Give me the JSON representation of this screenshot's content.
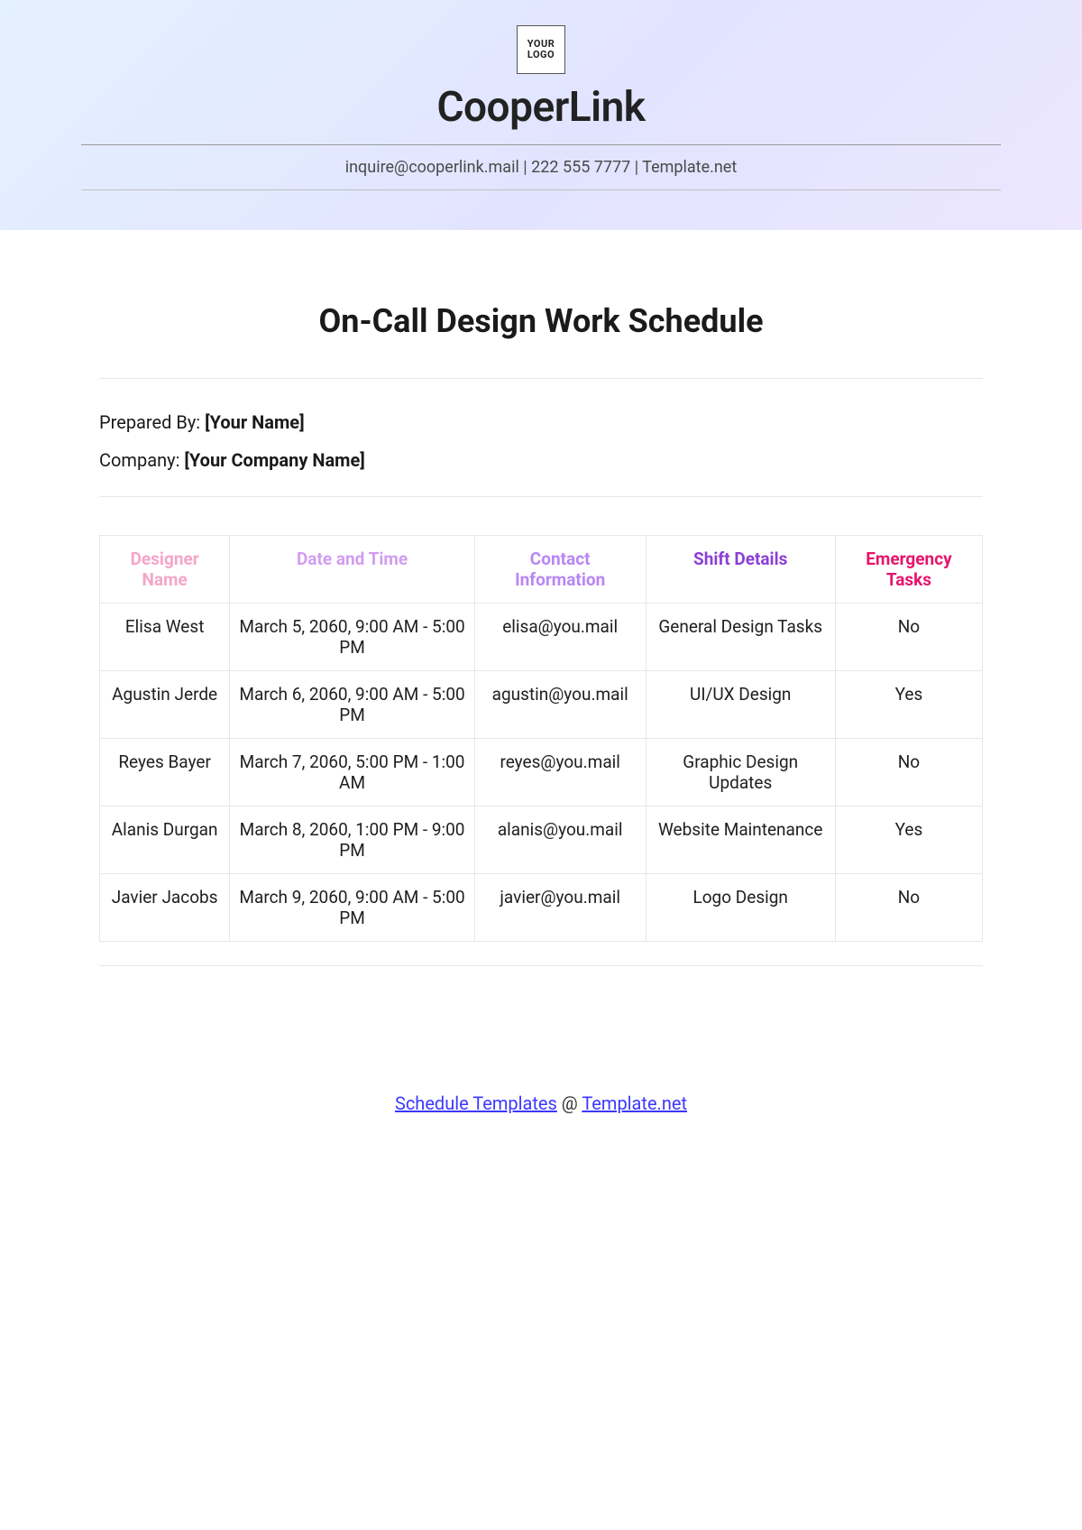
{
  "header": {
    "logo_text": "YOUR\nLOGO",
    "company_name": "CooperLink",
    "contact_line": "inquire@cooperlink.mail | 222 555 7777 | Template.net"
  },
  "doc_title": "On-Call Design Work Schedule",
  "meta": {
    "prepared_by_label": "Prepared By: ",
    "prepared_by_value": "[Your Name]",
    "company_label": "Company: ",
    "company_value": "[Your Company Name]"
  },
  "table": {
    "headers": [
      "Designer Name",
      "Date and Time",
      "Contact Information",
      "Shift Details",
      "Emergency Tasks"
    ],
    "rows": [
      [
        "Elisa West",
        "March 5, 2060, 9:00 AM - 5:00 PM",
        "elisa@you.mail",
        "General Design Tasks",
        "No"
      ],
      [
        "Agustin Jerde",
        "March 6, 2060, 9:00 AM - 5:00 PM",
        "agustin@you.mail",
        "UI/UX Design",
        "Yes"
      ],
      [
        "Reyes Bayer",
        "March 7, 2060, 5:00 PM - 1:00 AM",
        "reyes@you.mail",
        "Graphic Design Updates",
        "No"
      ],
      [
        "Alanis Durgan",
        "March 8, 2060, 1:00 PM - 9:00 PM",
        "alanis@you.mail",
        "Website Maintenance",
        "Yes"
      ],
      [
        "Javier Jacobs",
        "March 9, 2060, 9:00 AM - 5:00 PM",
        "javier@you.mail",
        "Logo Design",
        "No"
      ]
    ]
  },
  "footer": {
    "link1_text": "Schedule Templates",
    "sep": " @ ",
    "link2_text": "Template.net"
  }
}
